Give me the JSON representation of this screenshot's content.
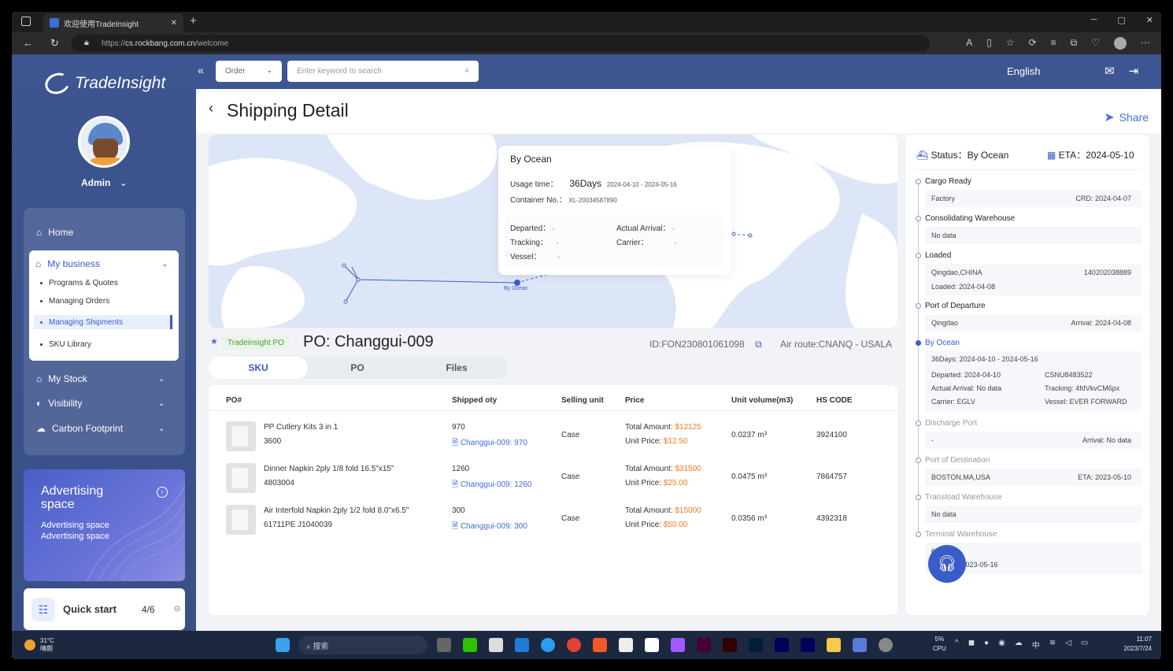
{
  "browser": {
    "tab_title": "欢迎使用TradeInsight",
    "url_prefix": "https://",
    "url_host": "cs.rockbang.com.cn",
    "url_path": "/welcome"
  },
  "brand": {
    "name": "TradeInsight",
    "accent": "#3d5590"
  },
  "user": {
    "name": "Admin"
  },
  "sidebar": {
    "home": "Home",
    "my_business": "My business",
    "sub_items": [
      "Programs & Quotes",
      "Managing Orders",
      "Managing Shipments",
      "SKU Library"
    ],
    "my_stock": "My Stock",
    "visibility": "Visibility",
    "carbon": "Carbon Footprint",
    "ad_title": "Advertising space",
    "ad_body": "Advertising space Advertising space",
    "quick_start": "Quick start",
    "quick_count": "4/6"
  },
  "topbar": {
    "order_select": "Order",
    "search_placeholder": "Enter keyword to search",
    "language": "English"
  },
  "page": {
    "title": "Shipping Detail",
    "share": "Share"
  },
  "map_popup": {
    "mode": "By Ocean",
    "usage_label": "Usage time：",
    "usage_days": "36Days",
    "usage_range": "2024-04-10 - 2024-05-16",
    "container_label": "Container No.：",
    "container_value": "XL-20034587890",
    "departed_label": "Departed：",
    "departed_value": "-",
    "arrival_label": "Actual Arrival：",
    "arrival_value": "-",
    "tracking_label": "Tracking：",
    "tracking_value": "-",
    "carrier_label": "Carrier：",
    "carrier_value": "-",
    "vessel_label": "Vessel：",
    "vessel_value": "-",
    "marker": "By Ocean"
  },
  "po": {
    "tag": "Tradeinsight PO",
    "number": "PO: Changgui-009",
    "id": "ID:FON230801061098",
    "route": "Air route:CNANQ - USALA",
    "tabs": [
      "SKU",
      "PO",
      "Files"
    ]
  },
  "table": {
    "headers": [
      "PO#",
      "Shipped oty",
      "Selling unit",
      "Price",
      "Unit volume(m3)",
      "HS CODE"
    ],
    "rows": [
      {
        "name": "PP Cutlery Kits 3 in 1",
        "code": "3600",
        "qty": "970",
        "link": "Changgui-009: 970",
        "unit": "Case",
        "total_label": "Total Amount: ",
        "total": "$12125",
        "price_label": "Unit Price: ",
        "price": "$12.50",
        "volume": "0.0237 m³",
        "hs": "3924100"
      },
      {
        "name": "Dinner Napkin 2ply 1/8 fold 16.5\"x15\"",
        "code": "4803004",
        "qty": "1260",
        "link": "Changgui-009: 1260",
        "unit": "Case",
        "total_label": "Total Amount: ",
        "total": "$31500",
        "price_label": "Unit Price: ",
        "price": "$25.00",
        "volume": "0.0475 m³",
        "hs": "7864757"
      },
      {
        "name": "Air Interfold Napkin 2ply 1/2 fold 8.0\"x6.5\"",
        "code": "61711PE J1040039",
        "qty": "300",
        "link": "Changgui-009: 300",
        "unit": "Case",
        "total_label": "Total Amount: ",
        "total": "$15000",
        "price_label": "Unit Price: ",
        "price": "$50.00",
        "volume": "0.0356 m³",
        "hs": "4392318"
      }
    ]
  },
  "status": {
    "status_text": "Status：By Ocean",
    "eta_text": "ETA：2024-05-10",
    "cargo_ready": "Cargo Ready",
    "factory": "Factory",
    "crd": "CRD: 2024-04-07",
    "consolidating": "Consolidating Warehouse",
    "no_data": "No data",
    "loaded": "Loaded",
    "loaded_place": "Qingdao,CHINA",
    "loaded_no": "140202038889",
    "loaded_date": "Loaded: 2024-04-08",
    "pod": "Port of Departure",
    "pod_place": "Qingdao",
    "pod_arrival": "Arrival: 2024-04-08",
    "ocean": "By Ocean",
    "ocean_days": "36Days: 2024-04-10 - 2024-05-16",
    "ocean_departed": "Departed: 2024-04-10",
    "ocean_csnu": "CSNU8483522",
    "ocean_arrival": "Actual Arrival: No data",
    "ocean_tracking": "Tracking: 4fdVkvCM6px",
    "ocean_carrier": "Carrier: EGLV",
    "ocean_vessel": "Vessel: EVER FORWARD",
    "discharge": "Discharge Port",
    "discharge_a": "-",
    "discharge_b": "Arrival: No data",
    "dest": "Port of Destination",
    "dest_place": "BOSTON,MA,USA",
    "dest_eta": "ETA: 2023-05-10",
    "transload": "Transload Warehouse",
    "terminal": "Terminal Warehouse",
    "terminal_code": "6252001",
    "terminal_etdoor": "ETDoor : 2023-05-16"
  },
  "taskbar": {
    "temp": "31°C",
    "weather": "晴朗",
    "search": "搜索",
    "cpu_pct": "5%",
    "cpu": "CPU",
    "time": "11:07",
    "date": "2023/7/24",
    "ime": "中"
  }
}
